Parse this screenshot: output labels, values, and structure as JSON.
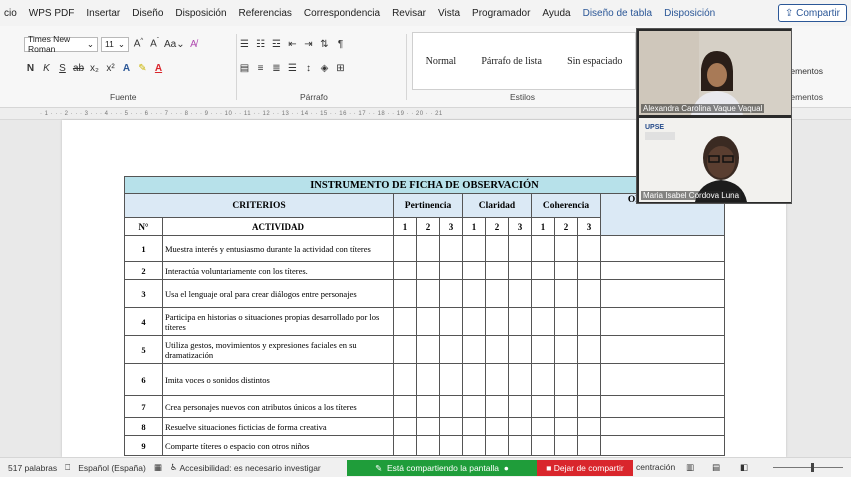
{
  "ribbon_tabs": [
    "cio",
    "WPS PDF",
    "Insertar",
    "Diseño",
    "Disposición",
    "Referencias",
    "Correspondencia",
    "Revisar",
    "Vista",
    "Programador",
    "Ayuda",
    "Diseño de tabla",
    "Disposición"
  ],
  "share_label": "Compartir",
  "font": {
    "name": "Times New Roman",
    "size": "11",
    "group_label": "Fuente"
  },
  "paragraph": {
    "group_label": "Párrafo"
  },
  "styles": {
    "items": [
      "Normal",
      "Párrafo de lista",
      "Sin espaciado"
    ],
    "group_label": "Estilos"
  },
  "elementos_top": "ementos",
  "elementos_bottom": "ementos",
  "ruler_text": "· 1 · · · 2 · · · 3 · · · 4 · · · 5 · · · 6 · · · 7 · · · 8 · · · 9 · · · 10 · · 11 · · 12 · · 13 · · 14 · · 15 · · 16 · · 17 · · 18 · · 19 · · 20 · · 21",
  "table": {
    "title": "INSTRUMENTO DE FICHA DE OBSERVACIÓN",
    "criterios": "CRITERIOS",
    "pertinencia": "Pertinencia",
    "claridad": "Claridad",
    "coherencia": "Coherencia",
    "observacion": "OBSERVACIÓN",
    "num_header": "N°",
    "actividad": "ACTIVIDAD",
    "scale": [
      "1",
      "2",
      "3"
    ],
    "rows": [
      {
        "n": "1",
        "text": "Muestra interés y entusiasmo durante la actividad con títeres"
      },
      {
        "n": "2",
        "text": "Interactúa voluntariamente con los títeres."
      },
      {
        "n": "3",
        "text": "Usa el lenguaje oral para crear diálogos entre personajes"
      },
      {
        "n": "4",
        "text": "Participa en historias o situaciones propias desarrollado por los títeres"
      },
      {
        "n": "5",
        "text": "Utiliza gestos, movimientos y expresiones faciales en su dramatización"
      },
      {
        "n": "6",
        "text": "Imita voces o sonidos distintos"
      },
      {
        "n": "7",
        "text": "Crea personajes nuevos con atributos únicos a los títeres"
      },
      {
        "n": "8",
        "text": "Resuelve situaciones ficticias de forma creativa"
      },
      {
        "n": "9",
        "text": "Comparte títeres o espacio con otros niños"
      }
    ]
  },
  "video": {
    "participant1": "Alexandra Carolina Vaque Vaqual",
    "participant2": "Maria Isabel Cordova Luna",
    "tile2_logo": "UPSE"
  },
  "status": {
    "words": "517 palabras",
    "language": "Español (España)",
    "accessibility": "Accesibilidad: es necesario investigar",
    "sharing": "Está compartiendo la pantalla",
    "stop_sharing": "Dejar de compartir",
    "focus": "centración"
  },
  "colors": {
    "title_bg": "#b7e1ea",
    "head_bg": "#dbe9f5",
    "share_green": "#1f9d3a",
    "stop_red": "#d9262c",
    "accent_blue": "#2b5797"
  }
}
